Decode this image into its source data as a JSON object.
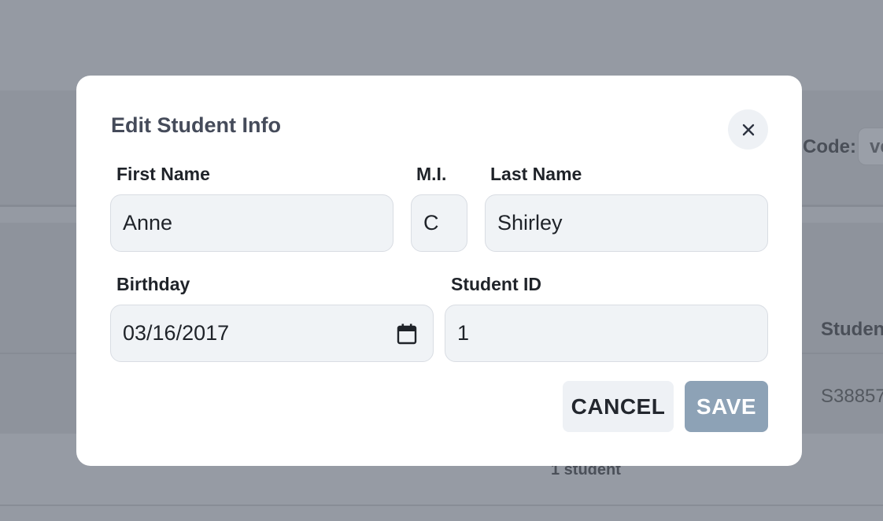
{
  "background": {
    "code_label": "Code:",
    "code_value": "ve",
    "table_column_header": "Student",
    "table_cell_value": "S38857",
    "student_count": "1 student"
  },
  "modal": {
    "title": "Edit Student Info",
    "close_icon": "close-icon",
    "fields": {
      "first_name": {
        "label": "First Name",
        "value": "Anne"
      },
      "middle_initial": {
        "label": "M.I.",
        "value": "C"
      },
      "last_name": {
        "label": "Last Name",
        "value": "Shirley"
      },
      "birthday": {
        "label": "Birthday",
        "value": "03/16/2017",
        "icon": "calendar-icon"
      },
      "student_id": {
        "label": "Student ID",
        "value": "1"
      }
    },
    "buttons": {
      "cancel": "CANCEL",
      "save": "SAVE"
    }
  },
  "colors": {
    "overlay": "#9298a1",
    "save_button": "#8da2b6",
    "input_background": "#f0f3f6",
    "title_text": "#454b5a"
  }
}
